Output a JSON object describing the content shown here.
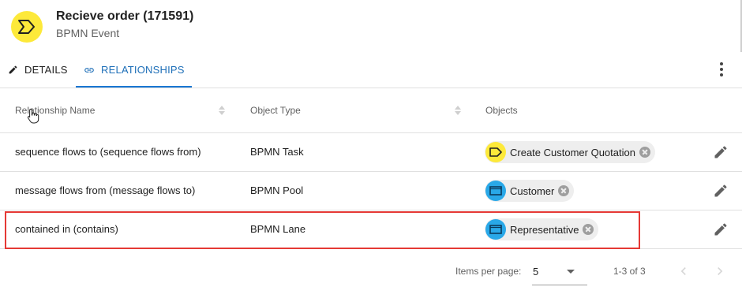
{
  "header": {
    "title": "Recieve order (171591)",
    "subtitle": "BPMN Event",
    "icon": "bpmn-event-icon",
    "icon_color": "#fde93a"
  },
  "tabs": [
    {
      "label": "DETAILS",
      "icon": "pencil-icon",
      "active": false
    },
    {
      "label": "RELATIONSHIPS",
      "icon": "link-icon",
      "active": true
    }
  ],
  "accent_color": "#1976d2",
  "table": {
    "columns": [
      "Relationship Name",
      "Object Type",
      "Objects"
    ],
    "rows": [
      {
        "name": "sequence flows to (sequence flows from)",
        "type": "BPMN Task",
        "object": "Create Customer Quotation",
        "object_icon": "bpmn-task-icon",
        "icon_color": "#fde93a"
      },
      {
        "name": "message flows from (message flows to)",
        "type": "BPMN Pool",
        "object": "Customer",
        "object_icon": "bpmn-pool-icon",
        "icon_color": "#29a8e8"
      },
      {
        "name": "contained in (contains)",
        "type": "BPMN Lane",
        "object": "Representative",
        "object_icon": "bpmn-lane-icon",
        "icon_color": "#29a8e8"
      }
    ]
  },
  "paginator": {
    "items_per_page_label": "Items per page:",
    "page_size": "5",
    "range": "1-3 of 3"
  },
  "highlight_color": "#e53935"
}
